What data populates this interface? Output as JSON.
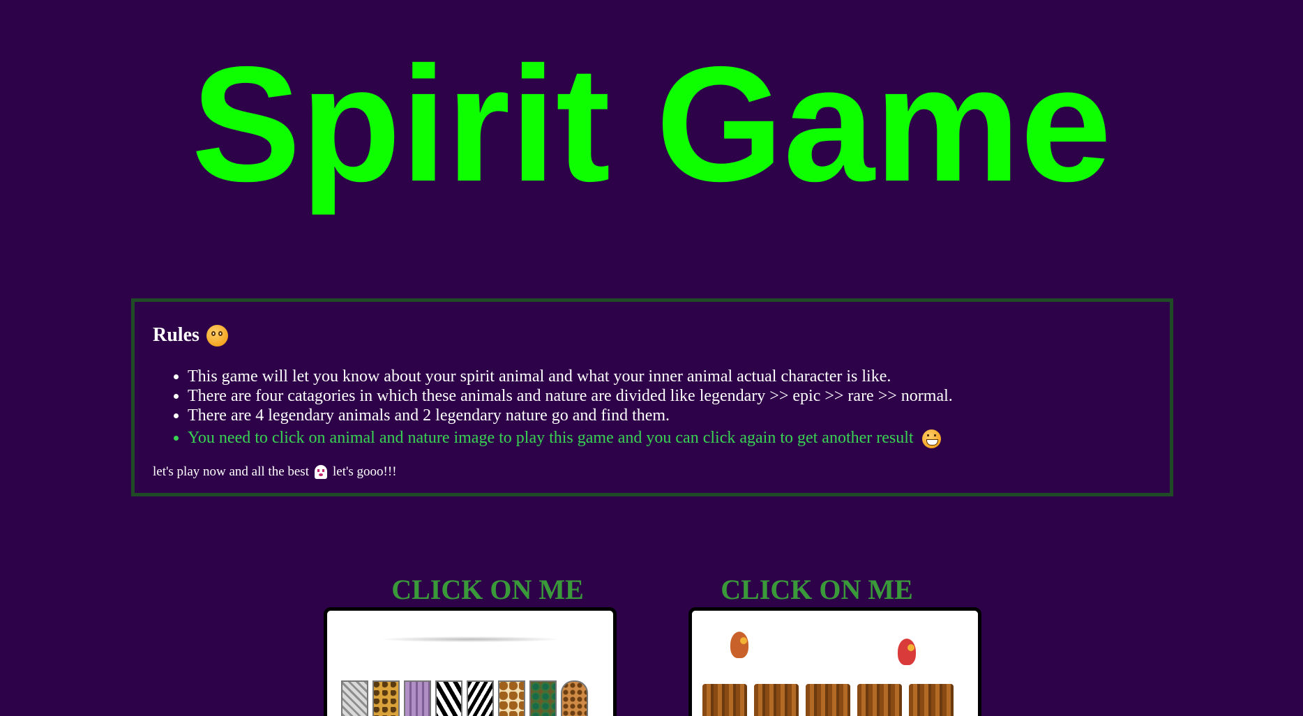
{
  "page": {
    "title": "Spirit Game"
  },
  "rules": {
    "heading": "Rules",
    "heading_icon": "smiling-face-emoji",
    "items": [
      "This game will let you know about your spirit animal and what your inner animal actual character is like.",
      "There are four catagories in which these animals and nature are divided like legendary >> epic >> rare >> normal.",
      "There are 4 legendary animals and 2 legendary nature go and find them.",
      "You need to click on animal and nature image to play this game and you can click again to get another result"
    ],
    "highlight_icon": "grinning-face-emoji",
    "footer_before": "let's play now and all the best",
    "footer_icon": "ghost-emoji",
    "footer_after": "let's gooo!!!"
  },
  "cards": {
    "animals": {
      "label": "CLICK ON ME",
      "image_alt": "ANIMALS"
    },
    "nature": {
      "label": "CLICK ON ME",
      "image_alt": "NATURE"
    }
  },
  "colors": {
    "background": "#2e0249",
    "title": "#0dff00",
    "rules_border": "#1f4b27",
    "highlight_text": "#39d353",
    "card_label": "#3a9a3a"
  }
}
